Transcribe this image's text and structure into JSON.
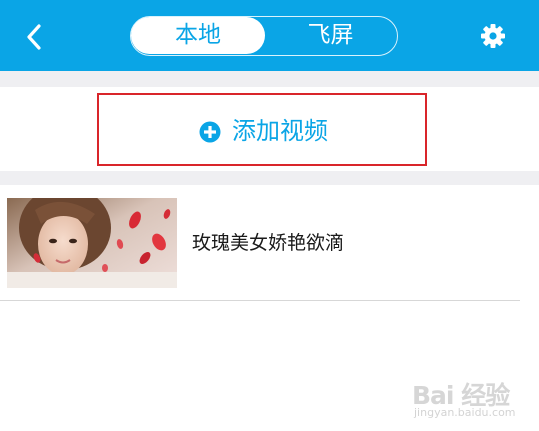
{
  "header": {
    "back_icon": "chevron-left-icon",
    "tabs": [
      {
        "label": "本地",
        "active": true
      },
      {
        "label": "飞屏",
        "active": false
      }
    ],
    "settings_icon": "gear-icon",
    "accent_color": "#0aa5e6"
  },
  "add_video": {
    "icon": "plus-circle-icon",
    "label": "添加视频",
    "highlight_color": "#d9252a"
  },
  "videos": [
    {
      "title": "玫瑰美女娇艳欲滴",
      "thumbnail": "video-thumbnail"
    }
  ],
  "watermark": {
    "logo": "Bai 经验",
    "domain": "jingyan.baidu.com"
  }
}
